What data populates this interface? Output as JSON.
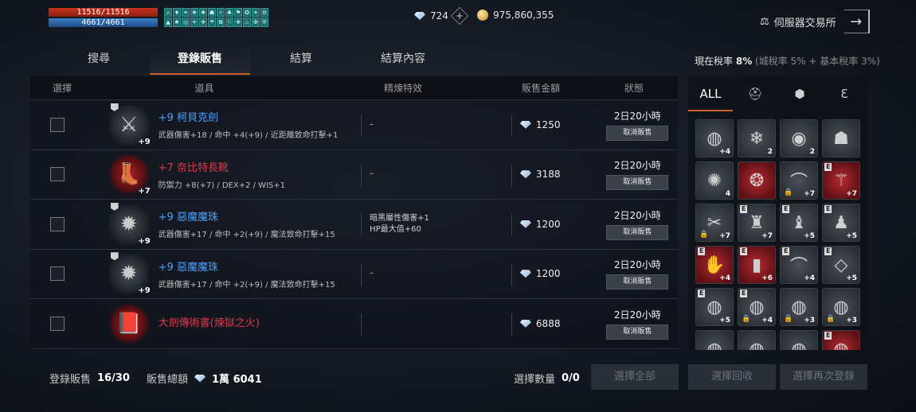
{
  "status": {
    "hp": "11516/11516",
    "mp": "4661/4661"
  },
  "buffs": [
    "⚔",
    "♦",
    "✦",
    "❖",
    "✚",
    "☗",
    "✧",
    "♣",
    "⚑",
    "✪",
    "☀",
    "⚙",
    "▲",
    "♠",
    "◎",
    "✛",
    "✜",
    "☂",
    "✿",
    "⚐",
    "✙",
    "♨",
    "✠",
    "⛨"
  ],
  "currency": {
    "diamonds": "724",
    "add_symbol": "+",
    "gold": "975,860,355"
  },
  "exchange": {
    "label": "伺服器交易所",
    "icon": "scale-icon",
    "arrow": "→"
  },
  "tabs": [
    {
      "label": "搜尋",
      "active": false
    },
    {
      "label": "登錄販售",
      "active": true
    },
    {
      "label": "結算",
      "active": false
    },
    {
      "label": "結算內容",
      "active": false
    }
  ],
  "tax": {
    "label": "現在稅率",
    "value": "8%",
    "detail": "(城稅率 5% + 基本稅率 3%)"
  },
  "table": {
    "headers": [
      "選擇",
      "道具",
      "精煉特效",
      "販售金額",
      "狀態"
    ],
    "rows": [
      {
        "icon": "axe-icon",
        "glyph": "⚔",
        "bg": "plain",
        "enh": "+9",
        "tier": true,
        "name": "+9 柯貝克劍",
        "name_color": "blue",
        "stats": "武器傷害+18 / 命中 +4(+9) / 近距離致命打擊+1",
        "special": "–",
        "price": "1250",
        "time": "2日20小時",
        "cancel": "取消販售"
      },
      {
        "icon": "boots-icon",
        "glyph": "👢",
        "bg": "red",
        "enh": "+7",
        "tier": false,
        "name": "+7 奈比特長靴",
        "name_color": "red",
        "stats": "防禦力 +8(+7) / DEX+2 / WIS+1",
        "special": "–",
        "price": "3188",
        "time": "2日20小時",
        "cancel": "取消販售"
      },
      {
        "icon": "demon-orb-icon",
        "glyph": "✹",
        "bg": "plain",
        "enh": "+9",
        "tier": true,
        "name": "+9 惡魔魔珠",
        "name_color": "blue",
        "stats": "武器傷害+17 / 命中 +2(+9) / 魔法致命打擊+15",
        "special": "暗黑屬性傷害+1\nHP最大值+60",
        "price": "1200",
        "time": "2日20小時",
        "cancel": "取消販售"
      },
      {
        "icon": "demon-orb-icon",
        "glyph": "✹",
        "bg": "plain",
        "enh": "+9",
        "tier": true,
        "name": "+9 惡魔魔珠",
        "name_color": "blue",
        "stats": "武器傷害+17 / 命中 +2(+9) / 魔法致命打擊+15",
        "special": "–",
        "price": "1200",
        "time": "2日20小時",
        "cancel": "取消販售"
      },
      {
        "icon": "book-icon",
        "glyph": "📕",
        "bg": "red",
        "enh": "",
        "tier": false,
        "name": "大劍傳術書(煉獄之火)",
        "name_color": "red",
        "stats": "",
        "special": "",
        "price": "6888",
        "time": "2日20小時",
        "cancel": "取消販售"
      }
    ]
  },
  "bottom": {
    "registered_label": "登錄販售",
    "registered_value": "16/30",
    "total_label": "販售總額",
    "total_value": "1萬 6041",
    "select_count_label": "選擇數量",
    "select_count_value": "0/0",
    "select_all": "選擇全部",
    "recall": "選擇回收",
    "reregister": "選擇再次登錄"
  },
  "inventory": {
    "tabs": [
      {
        "label": "ALL",
        "icon": "",
        "active": true
      },
      {
        "label": "",
        "icon": "helmet-icon",
        "glyph": "⛑",
        "active": false
      },
      {
        "label": "",
        "icon": "cube-icon",
        "glyph": "⬢",
        "active": false
      },
      {
        "label": "",
        "icon": "money-bag-icon",
        "glyph": "Ɛ",
        "active": false
      }
    ],
    "slots": [
      {
        "icon": "ring-icon",
        "glyph": "◍",
        "red": false,
        "num": "+4",
        "tag": "",
        "lock": false
      },
      {
        "icon": "crystal-icon",
        "glyph": "❄",
        "red": false,
        "num": "2",
        "tag": "",
        "lock": false
      },
      {
        "icon": "rainbow-orb-icon",
        "glyph": "◉",
        "red": false,
        "num": "2",
        "tag": "",
        "lock": false
      },
      {
        "icon": "hood-icon",
        "glyph": "☗",
        "red": false,
        "num": "",
        "tag": "",
        "lock": false
      },
      {
        "icon": "amulet-icon",
        "glyph": "✺",
        "red": false,
        "num": "4",
        "tag": "",
        "lock": false
      },
      {
        "icon": "gem-ring-icon",
        "glyph": "❂",
        "red": true,
        "num": "",
        "tag": "",
        "lock": false
      },
      {
        "icon": "bow-icon",
        "glyph": "⌒",
        "red": false,
        "num": "+7",
        "tag": "",
        "lock": true
      },
      {
        "icon": "claw-icon",
        "glyph": "⚚",
        "red": true,
        "num": "+7",
        "tag": "E",
        "lock": false
      },
      {
        "icon": "dagger-icon",
        "glyph": "✂",
        "red": false,
        "num": "+7",
        "tag": "",
        "lock": true
      },
      {
        "icon": "armor-icon",
        "glyph": "♜",
        "red": false,
        "num": "+7",
        "tag": "E",
        "lock": false
      },
      {
        "icon": "robe-icon",
        "glyph": "♝",
        "red": false,
        "num": "+5",
        "tag": "E",
        "lock": false
      },
      {
        "icon": "shirt-icon",
        "glyph": "♟",
        "red": false,
        "num": "+5",
        "tag": "E",
        "lock": false
      },
      {
        "icon": "glove-icon",
        "glyph": "✋",
        "red": true,
        "num": "+4",
        "tag": "E",
        "lock": false
      },
      {
        "icon": "greaves-icon",
        "glyph": "▮",
        "red": true,
        "num": "+6",
        "tag": "E",
        "lock": false
      },
      {
        "icon": "bow-icon",
        "glyph": "⌒",
        "red": false,
        "num": "+4",
        "tag": "E",
        "lock": false
      },
      {
        "icon": "necklace-icon",
        "glyph": "◇",
        "red": false,
        "num": "+5",
        "tag": "E",
        "lock": false
      },
      {
        "icon": "ring-icon",
        "glyph": "◍",
        "red": false,
        "num": "+5",
        "tag": "E",
        "lock": false
      },
      {
        "icon": "ring-icon",
        "glyph": "◍",
        "red": false,
        "num": "+4",
        "tag": "E",
        "lock": true
      },
      {
        "icon": "ring-icon",
        "glyph": "◍",
        "red": false,
        "num": "+3",
        "tag": "",
        "lock": true
      },
      {
        "icon": "ring-icon",
        "glyph": "◍",
        "red": false,
        "num": "+3",
        "tag": "",
        "lock": true
      },
      {
        "icon": "ring-icon",
        "glyph": "◍",
        "red": false,
        "num": "",
        "tag": "",
        "lock": false
      },
      {
        "icon": "ring-icon",
        "glyph": "◍",
        "red": false,
        "num": "",
        "tag": "",
        "lock": false
      },
      {
        "icon": "ring-icon",
        "glyph": "◍",
        "red": false,
        "num": "",
        "tag": "",
        "lock": false
      },
      {
        "icon": "ring-icon",
        "glyph": "◍",
        "red": true,
        "num": "",
        "tag": "E",
        "lock": false
      }
    ]
  }
}
